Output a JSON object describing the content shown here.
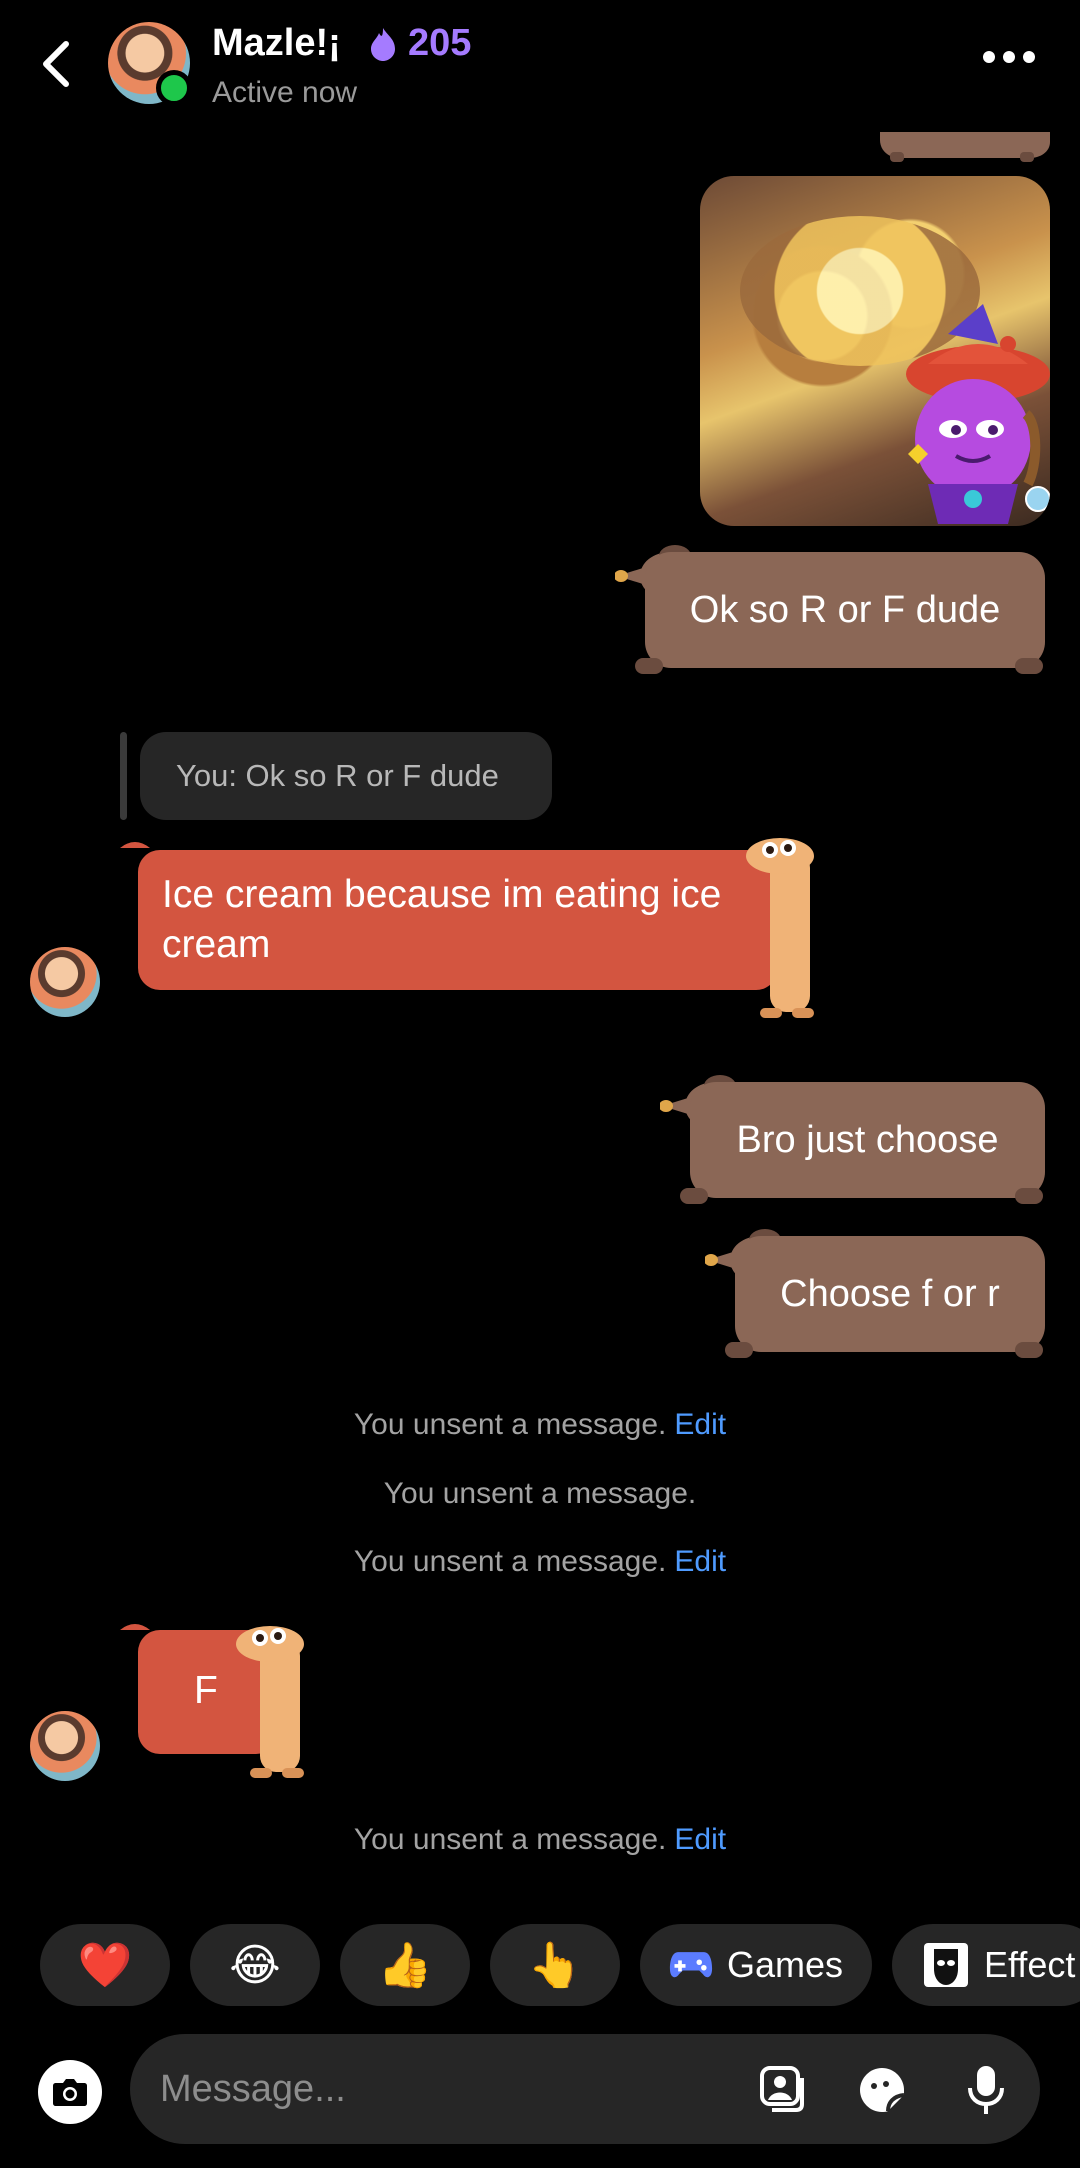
{
  "header": {
    "contact_name": "Mazle!¡",
    "streak_count": "205",
    "status": "Active now",
    "icons": {
      "back": "chevron-left-icon",
      "more": "more-horizontal-icon",
      "streak": "flame-icon"
    }
  },
  "messages": {
    "sent_1": "Ok so R or F dude",
    "reply_preview": "You: Ok so R or F dude",
    "received_1": "Ice cream because im eating ice cream",
    "sent_2": "Bro just choose",
    "sent_3": "Choose f or r",
    "system_1": "You unsent a message.",
    "system_1_action": "Edit",
    "system_2": "You unsent a message.",
    "system_3": "You unsent a message.",
    "system_3_action": "Edit",
    "received_2": "F",
    "system_4": "You unsent a message.",
    "system_4_action": "Edit"
  },
  "quick_actions": {
    "heart": "❤️",
    "laugh": "😂",
    "thumbs_up": "👍",
    "point": "👆",
    "games_label": "Games",
    "effects_label": "Effect"
  },
  "composer": {
    "placeholder": "Message...",
    "icons": [
      "camera-icon",
      "gallery-icon",
      "sticker-icon",
      "microphone-icon"
    ]
  },
  "colors": {
    "sent_bubble": "#8b6756",
    "received_bubble": "#d35540",
    "accent_purple": "#a57bff",
    "link_blue": "#4f9bff",
    "online_green": "#1ec74b"
  }
}
